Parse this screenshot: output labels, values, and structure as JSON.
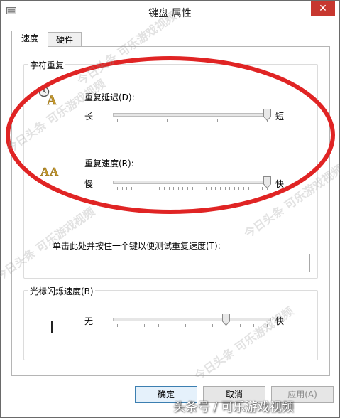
{
  "window": {
    "title": "键盘 属性",
    "close_glyph": "✕"
  },
  "tabs": [
    {
      "label": "速度",
      "active": true
    },
    {
      "label": "硬件",
      "active": false
    }
  ],
  "repeat_group": {
    "title": "字符重复",
    "delay": {
      "label": "重复延迟(D):",
      "min_label": "长",
      "max_label": "短",
      "ticks": 4,
      "value": 3
    },
    "rate": {
      "label": "重复速度(R):",
      "min_label": "慢",
      "max_label": "快",
      "ticks": 33,
      "value": 32
    },
    "test": {
      "label": "单击此处并按住一个键以便测试重复速度(T):",
      "value": ""
    }
  },
  "blink_group": {
    "title": "光标闪烁速度(B)",
    "min_label": "无",
    "max_label": "快",
    "ticks": 12,
    "value": 8
  },
  "buttons": {
    "ok": "确定",
    "cancel": "取消",
    "apply": "应用(A)"
  },
  "watermarks": {
    "diagonal": [
      "今日头条 可乐游戏视频",
      "今日头条 可乐游戏视频",
      "今日头条 可乐游戏视频",
      "今日头条 可乐游戏视频",
      "今日头条 可乐游戏视频"
    ],
    "bottom": "头条号 / 可乐游戏视频"
  },
  "colors": {
    "annotation_ellipse": "#e02424",
    "close_button": "#c7372f",
    "icon_gold": "#c79a2c"
  },
  "icons": [
    "keyboard-icon",
    "repeat-delay-icon",
    "repeat-rate-icon"
  ]
}
